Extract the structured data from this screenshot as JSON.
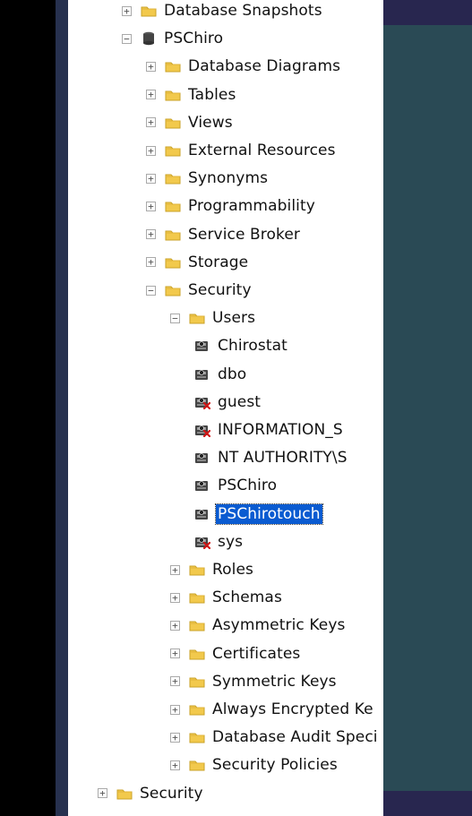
{
  "tree": [
    {
      "label": "Database Snapshots",
      "depth": 0,
      "icon": "folder-icon",
      "expander": "plus"
    },
    {
      "label": "PSChiro",
      "depth": 0,
      "icon": "database-icon",
      "expander": "minus"
    },
    {
      "label": "Database Diagrams",
      "depth": 1,
      "icon": "folder-icon",
      "expander": "plus"
    },
    {
      "label": "Tables",
      "depth": 1,
      "icon": "folder-icon",
      "expander": "plus"
    },
    {
      "label": "Views",
      "depth": 1,
      "icon": "folder-icon",
      "expander": "plus"
    },
    {
      "label": "External Resources",
      "depth": 1,
      "icon": "folder-icon",
      "expander": "plus"
    },
    {
      "label": "Synonyms",
      "depth": 1,
      "icon": "folder-icon",
      "expander": "plus"
    },
    {
      "label": "Programmability",
      "depth": 1,
      "icon": "folder-icon",
      "expander": "plus"
    },
    {
      "label": "Service Broker",
      "depth": 1,
      "icon": "folder-icon",
      "expander": "plus"
    },
    {
      "label": "Storage",
      "depth": 1,
      "icon": "folder-icon",
      "expander": "plus"
    },
    {
      "label": "Security",
      "depth": 1,
      "icon": "folder-icon",
      "expander": "minus"
    },
    {
      "label": "Users",
      "depth": 2,
      "icon": "folder-icon",
      "expander": "minus"
    },
    {
      "label": "Chirostat",
      "depth": 3,
      "icon": "user-icon",
      "expander": "none"
    },
    {
      "label": "dbo",
      "depth": 3,
      "icon": "user-icon",
      "expander": "none"
    },
    {
      "label": "guest",
      "depth": 3,
      "icon": "user-disabled-icon",
      "expander": "none"
    },
    {
      "label": "INFORMATION_S",
      "depth": 3,
      "icon": "user-disabled-icon",
      "expander": "none"
    },
    {
      "label": "NT AUTHORITY\\S",
      "depth": 3,
      "icon": "user-icon",
      "expander": "none"
    },
    {
      "label": "PSChiro",
      "depth": 3,
      "icon": "user-icon",
      "expander": "none"
    },
    {
      "label": "PSChirotouch",
      "depth": 3,
      "icon": "user-icon",
      "expander": "none",
      "selected": true
    },
    {
      "label": "sys",
      "depth": 3,
      "icon": "user-disabled-icon",
      "expander": "none"
    },
    {
      "label": "Roles",
      "depth": 2,
      "icon": "folder-icon",
      "expander": "plus"
    },
    {
      "label": "Schemas",
      "depth": 2,
      "icon": "folder-icon",
      "expander": "plus"
    },
    {
      "label": "Asymmetric Keys",
      "depth": 2,
      "icon": "folder-icon",
      "expander": "plus"
    },
    {
      "label": "Certificates",
      "depth": 2,
      "icon": "folder-icon",
      "expander": "plus"
    },
    {
      "label": "Symmetric Keys",
      "depth": 2,
      "icon": "folder-icon",
      "expander": "plus"
    },
    {
      "label": "Always Encrypted Ke",
      "depth": 2,
      "icon": "folder-icon",
      "expander": "plus"
    },
    {
      "label": "Database Audit Speci",
      "depth": 2,
      "icon": "folder-icon",
      "expander": "plus"
    },
    {
      "label": "Security Policies",
      "depth": 2,
      "icon": "folder-icon",
      "expander": "plus"
    },
    {
      "label": "Security",
      "depth": -1,
      "icon": "folder-icon",
      "expander": "plus"
    }
  ]
}
